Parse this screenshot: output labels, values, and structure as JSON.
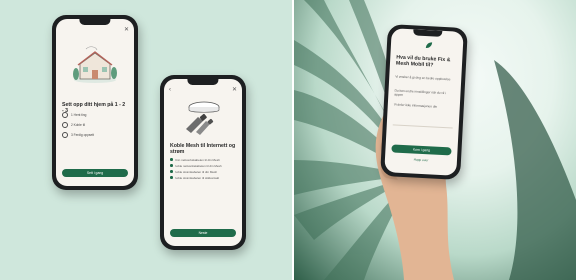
{
  "colors": {
    "accent": "#1f6b4a",
    "left_background": "#cfe7dc",
    "screen_background": "#f7f4ef"
  },
  "screen1": {
    "title": "Sett opp ditt hjem på 1 - 2 - 3",
    "icons": [
      "close-icon",
      "house-illustration",
      "router-icon",
      "plug-icon",
      "check-icon"
    ],
    "options": [
      {
        "label": "1 Hent ting"
      },
      {
        "label": "2 Koble til"
      },
      {
        "label": "3 Ferdig oppsett"
      }
    ],
    "button_label": "Sett i gang"
  },
  "screen2": {
    "title": "Koble Mesh til Internett og strøm",
    "icons": [
      "back-icon",
      "close-icon",
      "router-cable-illustration"
    ],
    "checklist": [
      "Finn nettverkskabelen til din Mesh",
      "Koble nettverkskabelen til din Mesh",
      "Koble strømkabelen til din Mesh",
      "Koble strømkabelen til stikkontakt"
    ],
    "button_label": "Neste"
  },
  "screen3": {
    "title": "Hva vil du bruke Fix & Mesh Mobil til?",
    "icons": [
      "leaf-logo-icon"
    ],
    "paragraphs": [
      "Vi ønsker å gi deg en bedre opplevelse",
      "Du kan endre innstillinger når du vil i appen",
      "Vi deler ikke informasjonen din"
    ],
    "button_label": "Kom i gang",
    "link_label": "Hopp over"
  }
}
